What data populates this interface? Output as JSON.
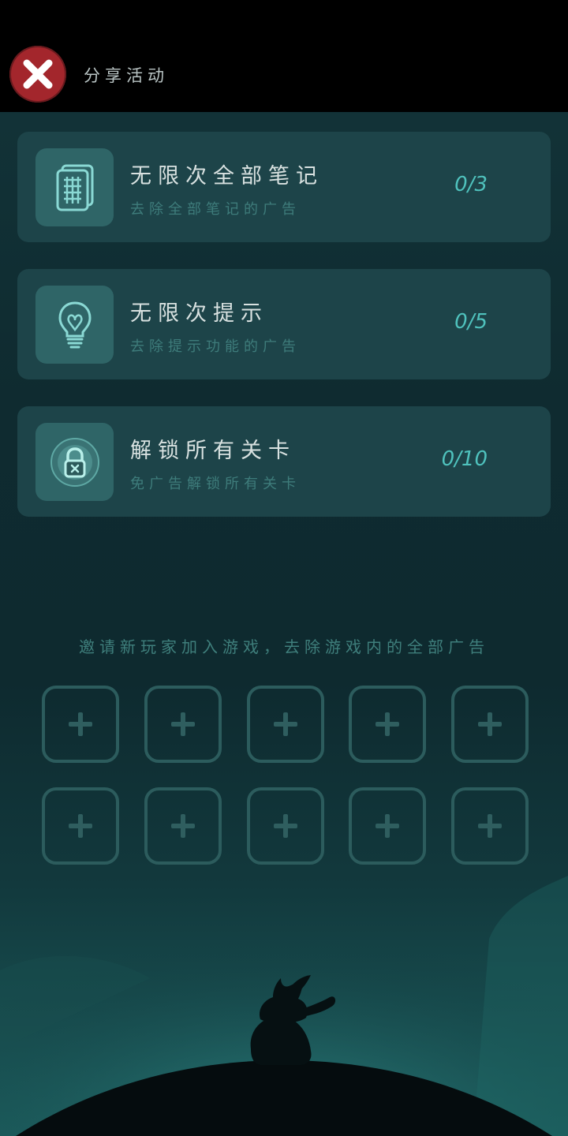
{
  "header": {
    "title": "分享活动",
    "close_icon": "close-icon"
  },
  "colors": {
    "close_button": "#a3262c",
    "accent": "#4fc2bd",
    "card_background": "#1d4449"
  },
  "cards": [
    {
      "icon": "notes-grid-icon",
      "title": "无限次全部笔记",
      "subtitle": "去除全部笔记的广告",
      "count": "0/3"
    },
    {
      "icon": "lightbulb-icon",
      "title": "无限次提示",
      "subtitle": "去除提示功能的广告",
      "count": "0/5"
    },
    {
      "icon": "padlock-icon",
      "title": "解锁所有关卡",
      "subtitle": "免广告解锁所有关卡",
      "count": "0/10"
    }
  ],
  "invite": {
    "text": "邀请新玩家加入游戏，去除游戏内的全部广告",
    "slot_icon": "plus-icon",
    "slot_count": 10
  },
  "scene": {
    "illustration": "boy-sitting-on-planet"
  }
}
